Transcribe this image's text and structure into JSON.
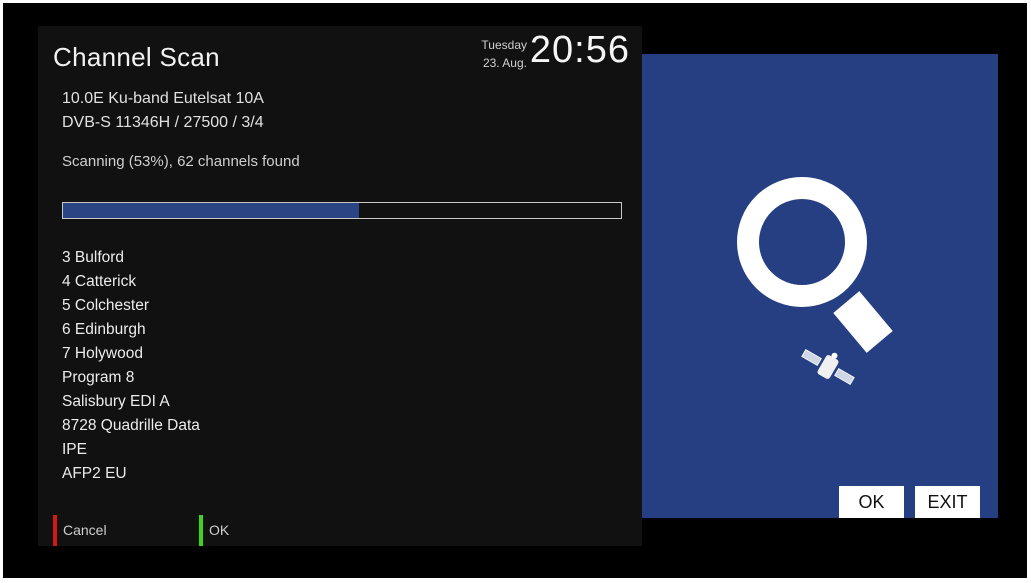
{
  "title": "Channel Scan",
  "clock": {
    "day": "Tuesday",
    "date": "23. Aug.",
    "time": "20:56"
  },
  "transponder": {
    "satellite": "10.0E Ku-band Eutelsat 10A",
    "params": "DVB-S 11346H / 27500 / 3/4"
  },
  "status": "Scanning (53%), 62 channels found",
  "progress": 0.53,
  "channels": [
    "3 Bulford",
    "4 Catterick",
    "5 Colchester",
    "6 Edinburgh",
    "7 Holywood",
    "Program 8",
    "Salisbury EDI A",
    "8728 Quadrille Data",
    "IPE",
    "AFP2 EU"
  ],
  "keys": [
    {
      "label": "Cancel",
      "color": "#d21a10"
    },
    {
      "label": "OK",
      "color": "#3ed41c"
    }
  ],
  "buttons": {
    "ok": "OK",
    "exit": "EXIT"
  },
  "colors": {
    "panel": "#111111",
    "accent": "#253f82",
    "progress": "#2b4484"
  },
  "icons": [
    "magnifier-icon",
    "satellite-icon"
  ]
}
